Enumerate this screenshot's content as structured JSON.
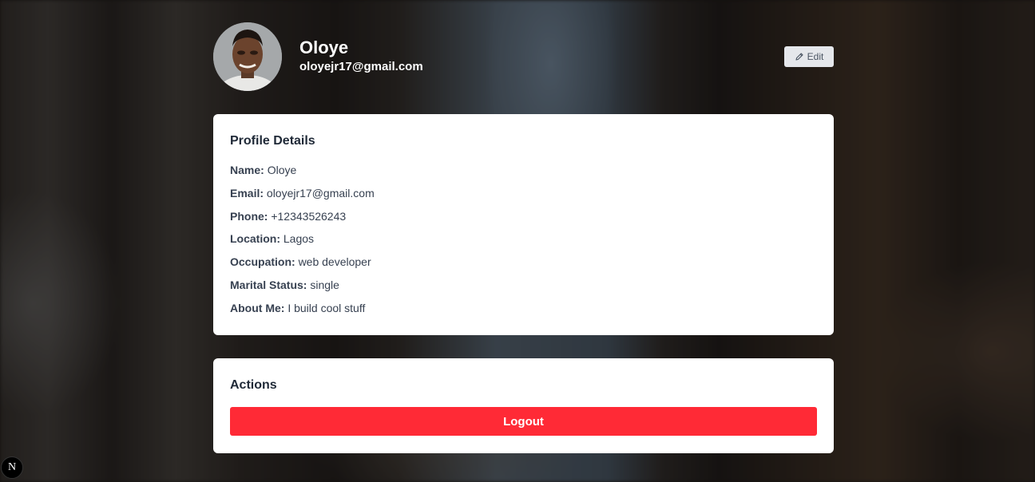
{
  "profile": {
    "name": "Oloye",
    "email": "oloyejr17@gmail.com",
    "edit_label": "Edit"
  },
  "details": {
    "title": "Profile Details",
    "rows": [
      {
        "label": "Name:",
        "value": "Oloye"
      },
      {
        "label": "Email:",
        "value": "oloyejr17@gmail.com"
      },
      {
        "label": "Phone:",
        "value": "+12343526243"
      },
      {
        "label": "Location:",
        "value": "Lagos"
      },
      {
        "label": "Occupation:",
        "value": "web developer"
      },
      {
        "label": "Marital Status:",
        "value": "single"
      },
      {
        "label": "About Me:",
        "value": "I build cool stuff"
      }
    ]
  },
  "actions": {
    "title": "Actions",
    "logout_label": "Logout"
  },
  "dev_badge": {
    "letter": "N"
  },
  "icons": {
    "edit": "pencil-icon",
    "avatar": "user-avatar"
  },
  "colors": {
    "logout": "#ff2a36",
    "card": "#ffffff",
    "edit_button": "#e5e7eb"
  }
}
